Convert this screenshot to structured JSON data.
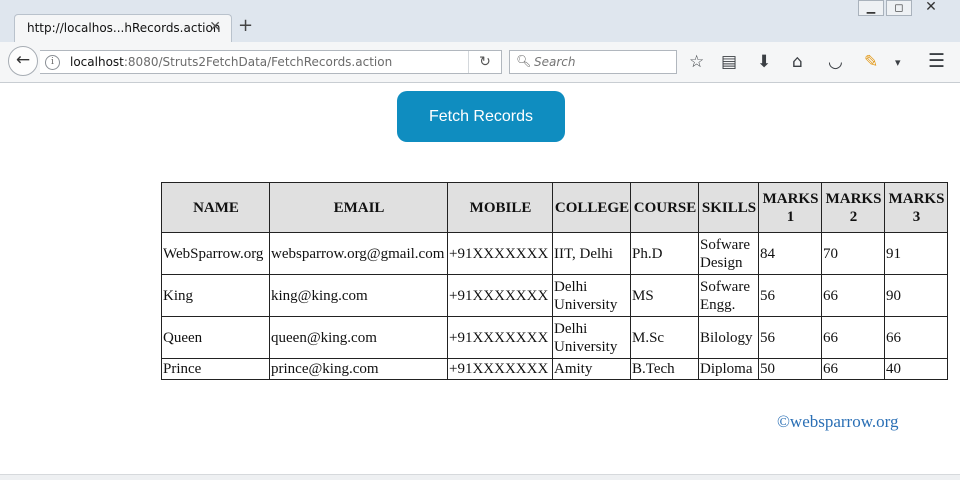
{
  "browser": {
    "tab_title": "http://localhos...hRecords.action",
    "tab_close": "✕",
    "new_tab": "+",
    "url_host": "localhost",
    "url_rest": ":8080/Struts2FetchData/FetchRecords.action",
    "search_placeholder": "Search",
    "icons": [
      "back-icon",
      "info-icon",
      "reload-icon",
      "search-icon",
      "star-icon",
      "reading-list-icon",
      "download-icon",
      "home-icon",
      "pocket-icon",
      "pencil-icon",
      "chevron-down-icon",
      "menu-icon"
    ]
  },
  "page": {
    "fetch_button": "Fetch Records",
    "table": {
      "headers": [
        "NAME",
        "EMAIL",
        "MOBILE",
        "COLLEGE",
        "COURSE",
        "SKILLS",
        "MARKS 1",
        "MARKS 2",
        "MARKS 3"
      ],
      "rows": [
        [
          "WebSparrow.org",
          "websparrow.org@gmail.com",
          "+91XXXXXXX",
          "IIT, Delhi",
          "Ph.D",
          "Sofware Design",
          "84",
          "70",
          "91"
        ],
        [
          "King",
          "king@king.com",
          "+91XXXXXXX",
          "Delhi University",
          "MS",
          "Sofware Engg.",
          "56",
          "66",
          "90"
        ],
        [
          "Queen",
          "queen@king.com",
          "+91XXXXXXX",
          "Delhi University",
          "M.Sc",
          "Bilology",
          "56",
          "66",
          "66"
        ],
        [
          "Prince",
          "prince@king.com",
          "+91XXXXXXX",
          "Amity",
          "B.Tech",
          "Diploma",
          "50",
          "66",
          "40"
        ]
      ]
    },
    "footer": "©websparrow.org"
  },
  "colors": {
    "button_bg": "#0f8dc0",
    "footer_link": "#2a6fb5",
    "header_bg": "#e0e0e0"
  }
}
